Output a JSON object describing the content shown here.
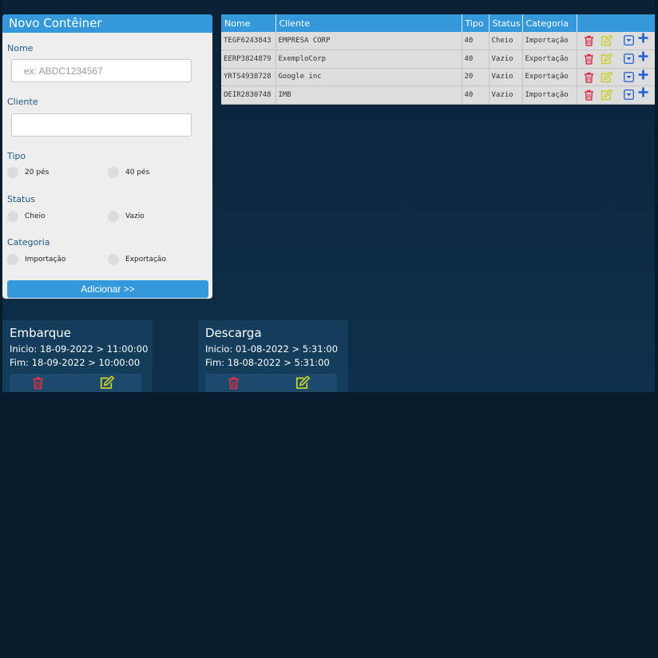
{
  "form": {
    "title": "Novo Contêiner",
    "name_label": "Nome",
    "name_placeholder": "ex: ABDC1234567",
    "name_value": "",
    "client_label": "Cliente",
    "client_value": "",
    "type_label": "Tipo",
    "type_options": [
      "20 pés",
      "40 pés"
    ],
    "status_label": "Status",
    "status_options": [
      "Cheio",
      "Vazio"
    ],
    "category_label": "Categoria",
    "category_options": [
      "Importação",
      "Exportação"
    ],
    "add_label": "Adicionar >>"
  },
  "table": {
    "headers": [
      "Nome",
      "Cliente",
      "Tipo",
      "Status",
      "Categoria",
      ""
    ],
    "rows": [
      {
        "nome": "TEGF6243843",
        "cliente": "EMPRESA CORP",
        "tipo": "40",
        "status": "Cheio",
        "categoria": "Importação"
      },
      {
        "nome": "EERP3824879",
        "cliente": "ExemploCorp",
        "tipo": "40",
        "status": "Vazio",
        "categoria": "Exportação"
      },
      {
        "nome": "YRTS4938728",
        "cliente": "Google inc",
        "tipo": "20",
        "status": "Vazio",
        "categoria": "Exportação"
      },
      {
        "nome": "OEIR2830748",
        "cliente": "IMB",
        "tipo": "40",
        "status": "Vazio",
        "categoria": "Importação"
      }
    ],
    "row_actions": [
      "trash-icon",
      "edit-icon",
      "dropdown-icon",
      "plus-icon"
    ]
  },
  "movements": [
    {
      "title": "Embarque",
      "start": "Inicio: 18-09-2022 > 11:00:00",
      "end": "Fim: 18-09-2022 > 10:00:00"
    },
    {
      "title": "Descarga",
      "start": "Inicio: 01-08-2022 > 5:31:00",
      "end": "Fim: 18-08-2022 > 5:31:00"
    }
  ],
  "colors": {
    "accent": "#3498db",
    "delete": "#d9304a",
    "edit": "#c9cf2b",
    "add": "#1f5fd6",
    "background": "#061b2c"
  }
}
